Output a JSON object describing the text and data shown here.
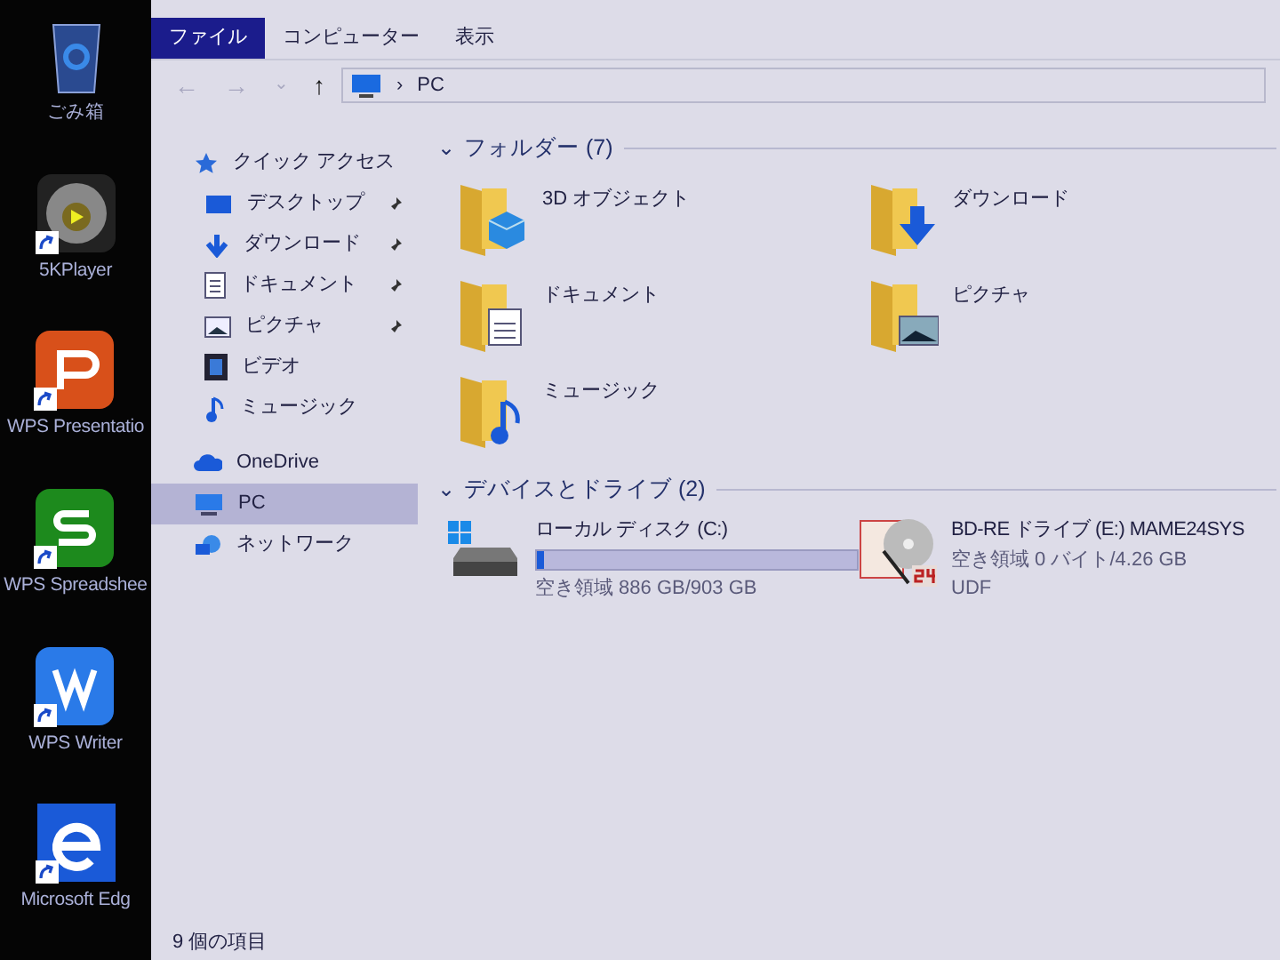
{
  "desktop": {
    "icons": [
      {
        "label": "ごみ箱",
        "kind": "recycle",
        "shortcut": false
      },
      {
        "label": "5KPlayer",
        "kind": "player",
        "shortcut": true
      },
      {
        "label": "WPS Presentatio",
        "kind": "wps-p",
        "shortcut": true
      },
      {
        "label": "WPS Spreadshee",
        "kind": "wps-s",
        "shortcut": true
      },
      {
        "label": "WPS Writer",
        "kind": "wps-w",
        "shortcut": true
      },
      {
        "label": "Microsoft Edg",
        "kind": "edge",
        "shortcut": true
      }
    ]
  },
  "ribbon": {
    "tabs": [
      {
        "label": "ファイル",
        "selected": true
      },
      {
        "label": "コンピューター",
        "selected": false
      },
      {
        "label": "表示",
        "selected": false
      }
    ]
  },
  "address_bar": {
    "back": "←",
    "forward": "→",
    "recent": "⌄",
    "up": "↑",
    "separator": "›",
    "path": "PC"
  },
  "nav_pane": {
    "items": [
      {
        "label": "クイック アクセス",
        "kind": "star",
        "selected": false,
        "children": [
          {
            "label": "デスクトップ",
            "kind": "desktop",
            "pinned": true,
            "selected": false
          },
          {
            "label": "ダウンロード",
            "kind": "download",
            "pinned": true,
            "selected": false
          },
          {
            "label": "ドキュメント",
            "kind": "document",
            "pinned": true,
            "selected": false
          },
          {
            "label": "ピクチャ",
            "kind": "picture",
            "pinned": true,
            "selected": false
          },
          {
            "label": "ビデオ",
            "kind": "video",
            "pinned": false,
            "selected": false
          },
          {
            "label": "ミュージック",
            "kind": "music",
            "pinned": false,
            "selected": false
          }
        ]
      },
      {
        "label": "OneDrive",
        "kind": "cloud",
        "selected": false
      },
      {
        "label": "PC",
        "kind": "pc",
        "selected": true
      },
      {
        "label": "ネットワーク",
        "kind": "network",
        "selected": false
      }
    ]
  },
  "groups": [
    {
      "title": "フォルダー (7)",
      "toggle": "⌄",
      "expanded": true,
      "kind": "folders",
      "items": [
        {
          "label": "3D オブジェクト",
          "kind": "cube"
        },
        {
          "label": "ダウンロード",
          "kind": "download"
        },
        {
          "label": "ドキュメント",
          "kind": "document"
        },
        {
          "label": "ピクチャ",
          "kind": "picture"
        },
        {
          "label": "ミュージック",
          "kind": "music"
        }
      ]
    },
    {
      "title": "デバイスとドライブ (2)",
      "toggle": "⌄",
      "expanded": true,
      "kind": "drives",
      "items": [
        {
          "label": "ローカル ディスク (C:)",
          "kind": "disk",
          "level": 0.02,
          "free": "空き領域 886 GB/903 GB"
        },
        {
          "label": "BD-RE ドライブ (E:) MAME24SYS",
          "kind": "disc",
          "free": "空き領域 0 バイト/4.26 GB",
          "filesystem": "UDF"
        }
      ]
    }
  ],
  "status_bar": {
    "count": "9 個の項目"
  }
}
